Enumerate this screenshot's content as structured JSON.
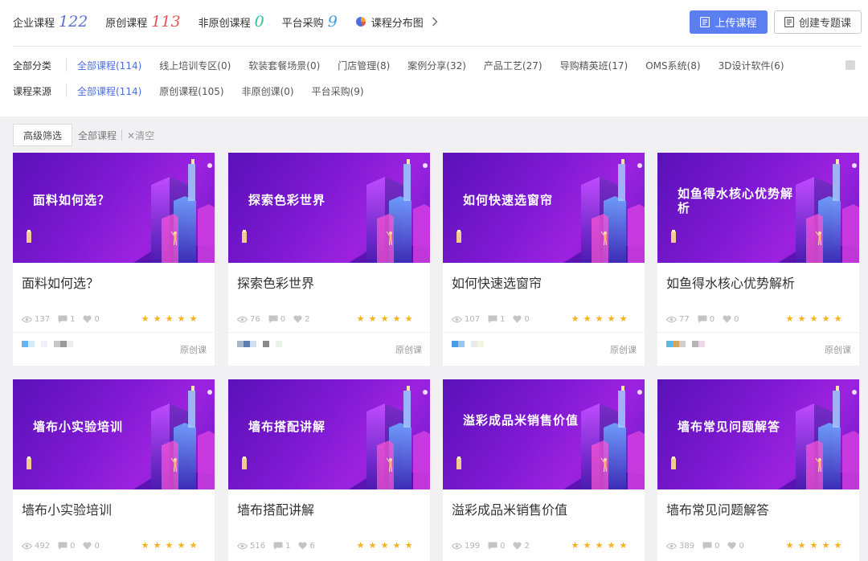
{
  "header": {
    "stats": [
      {
        "label": "企业课程",
        "value": "122",
        "color": "#5b6fcf"
      },
      {
        "label": "原创课程",
        "value": "113",
        "color": "#e25558"
      },
      {
        "label": "非原创课程",
        "value": "0",
        "color": "#2fbfa0"
      },
      {
        "label": "平台采购",
        "value": "9",
        "color": "#3aa0e0"
      }
    ],
    "distribution_link": "课程分布图",
    "upload_label": "上传课程",
    "create_label": "创建专题课"
  },
  "filters": {
    "category": {
      "label": "全部分类",
      "options": [
        "全部课程(114)",
        "线上培训专区(0)",
        "软装套餐场景(0)",
        "门店管理(8)",
        "案例分享(32)",
        "产品工艺(27)",
        "导购精英班(17)",
        "OMS系统(8)",
        "3D设计软件(6)"
      ]
    },
    "source": {
      "label": "课程来源",
      "options": [
        "全部课程(114)",
        "原创课程(105)",
        "非原创课(0)",
        "平台采购(9)"
      ]
    }
  },
  "subbar": {
    "advanced_label": "高级筛选",
    "tag": "全部课程",
    "clear_label": "清空"
  },
  "courses": [
    {
      "cover_title": "面料如何选？",
      "title": "面料如何选？",
      "views": "137",
      "comments": "1",
      "likes": "0",
      "rating": 5,
      "origin": "原创课"
    },
    {
      "cover_title": "探索色彩世界",
      "title": "探索色彩世界",
      "views": "76",
      "comments": "0",
      "likes": "2",
      "rating": 5,
      "origin": "原创课"
    },
    {
      "cover_title": "如何快速选窗帘",
      "title": "如何快速选窗帘",
      "views": "107",
      "comments": "1",
      "likes": "0",
      "rating": 5,
      "origin": "原创课"
    },
    {
      "cover_title": "如鱼得水核心优势解析",
      "title": "如鱼得水核心优势解析",
      "views": "77",
      "comments": "0",
      "likes": "0",
      "rating": 5,
      "origin": "原创课"
    },
    {
      "cover_title": "墙布小实验培训",
      "title": "墙布小实验培训",
      "views": "492",
      "comments": "0",
      "likes": "0",
      "rating": 5
    },
    {
      "cover_title": "墙布搭配讲解",
      "title": "墙布搭配讲解",
      "views": "516",
      "comments": "1",
      "likes": "6",
      "rating": 5
    },
    {
      "cover_title": "溢彩成品米销售价值",
      "title": "溢彩成品米销售价值",
      "views": "199",
      "comments": "0",
      "likes": "2",
      "rating": 5
    },
    {
      "cover_title": "墙布常见问题解答",
      "title": "墙布常见问题解答",
      "views": "389",
      "comments": "0",
      "likes": "0",
      "rating": 5
    }
  ],
  "icons": {
    "distribution": "pie-chart-icon",
    "upload": "document-icon",
    "create": "document-icon",
    "views": "eye-icon",
    "comments": "comment-icon",
    "likes": "heart-icon",
    "rating": "star-icon"
  },
  "colors": {
    "accent": "#4a6ee0",
    "upload_button": "#5b7ff0",
    "star": "#f5b21b"
  }
}
